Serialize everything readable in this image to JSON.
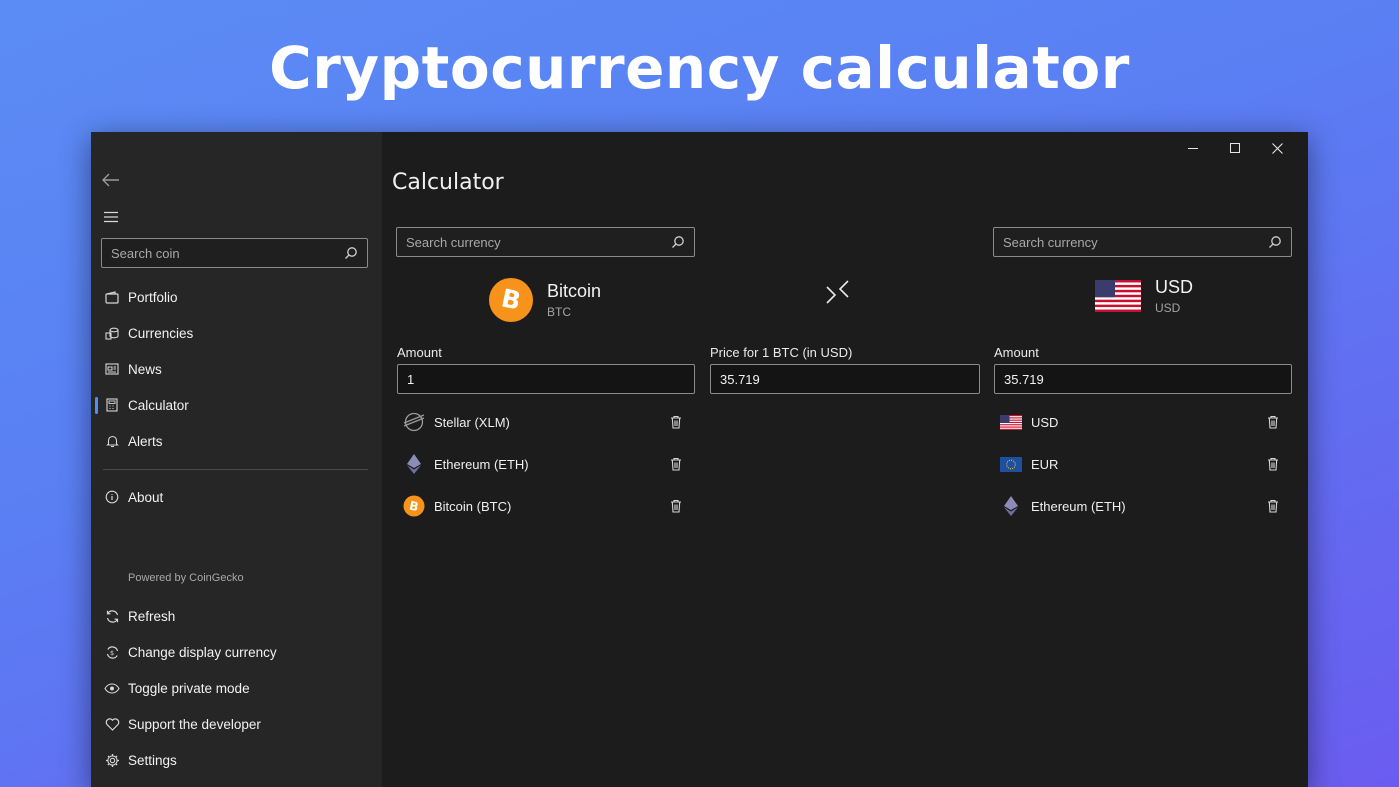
{
  "hero": {
    "title": "Cryptocurrency calculator"
  },
  "sidebar": {
    "search_placeholder": "Search coin",
    "items": [
      {
        "label": "Portfolio",
        "icon": "wallet-icon"
      },
      {
        "label": "Currencies",
        "icon": "coins-icon"
      },
      {
        "label": "News",
        "icon": "newspaper-icon"
      },
      {
        "label": "Calculator",
        "icon": "calculator-icon",
        "active": true
      },
      {
        "label": "Alerts",
        "icon": "bell-icon"
      }
    ],
    "about_label": "About",
    "powered_by": "Powered by CoinGecko",
    "footer_items": [
      {
        "label": "Refresh",
        "icon": "refresh-icon"
      },
      {
        "label": "Change display currency",
        "icon": "currency-exchange-icon"
      },
      {
        "label": "Toggle private mode",
        "icon": "eye-icon"
      },
      {
        "label": "Support the developer",
        "icon": "heart-icon"
      },
      {
        "label": "Settings",
        "icon": "gear-icon"
      }
    ]
  },
  "main": {
    "title": "Calculator",
    "left": {
      "search_placeholder": "Search currency",
      "coin_name": "Bitcoin",
      "coin_symbol": "BTC",
      "amount_label": "Amount",
      "amount_value": "1",
      "list": [
        {
          "label": "Stellar (XLM)",
          "icon": "stellar-icon"
        },
        {
          "label": "Ethereum (ETH)",
          "icon": "ethereum-icon"
        },
        {
          "label": "Bitcoin (BTC)",
          "icon": "bitcoin-icon"
        }
      ]
    },
    "middle": {
      "price_label": "Price for 1 BTC (in USD)",
      "price_value": "35.719"
    },
    "right": {
      "search_placeholder": "Search currency",
      "coin_name": "USD",
      "coin_symbol": "USD",
      "amount_label": "Amount",
      "amount_value": "35.719",
      "list": [
        {
          "label": "USD",
          "icon": "us-flag-icon"
        },
        {
          "label": "EUR",
          "icon": "eu-flag-icon"
        },
        {
          "label": "Ethereum (ETH)",
          "icon": "ethereum-icon"
        }
      ]
    }
  },
  "colors": {
    "bitcoin": "#f7931a",
    "accent": "#4f8ff7",
    "background_top": "#5b8cf5",
    "background_bottom": "#6a5cf0"
  }
}
